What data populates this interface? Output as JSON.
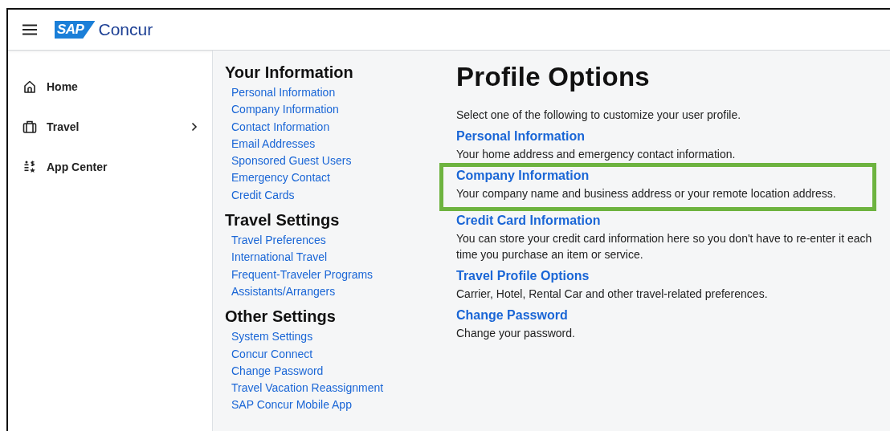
{
  "header": {
    "logo_mark": "SAP",
    "logo_text": "Concur"
  },
  "sidebar": {
    "items": [
      {
        "label": "Home",
        "kind": "home",
        "has_submenu": false
      },
      {
        "label": "Travel",
        "kind": "travel",
        "has_submenu": true
      },
      {
        "label": "App Center",
        "kind": "apps",
        "has_submenu": false
      }
    ]
  },
  "nav_sections": [
    {
      "heading": "Your Information",
      "links": [
        "Personal Information",
        "Company Information",
        "Contact Information",
        "Email Addresses",
        "Sponsored Guest Users",
        "Emergency Contact",
        "Credit Cards"
      ]
    },
    {
      "heading": "Travel Settings",
      "links": [
        "Travel Preferences",
        "International Travel",
        "Frequent-Traveler Programs",
        "Assistants/Arrangers"
      ]
    },
    {
      "heading": "Other Settings",
      "links": [
        "System Settings",
        "Concur Connect",
        "Change Password",
        "Travel Vacation Reassignment",
        "SAP Concur Mobile App"
      ]
    }
  ],
  "main": {
    "title": "Profile Options",
    "intro": "Select one of the following to customize your user profile.",
    "options": [
      {
        "title": "Personal Information",
        "description": "Your home address and emergency contact information.",
        "highlighted": false
      },
      {
        "title": "Company Information",
        "description": "Your company name and business address or your remote location address.",
        "highlighted": true
      },
      {
        "title": "Credit Card Information",
        "description": "You can store your credit card information here so you don't have to re-enter it each time you purchase an item or service.",
        "highlighted": false
      },
      {
        "title": "Travel Profile Options",
        "description": "Carrier, Hotel, Rental Car and other travel-related preferences.",
        "highlighted": false
      },
      {
        "title": "Change Password",
        "description": "Change your password.",
        "highlighted": false
      }
    ]
  }
}
